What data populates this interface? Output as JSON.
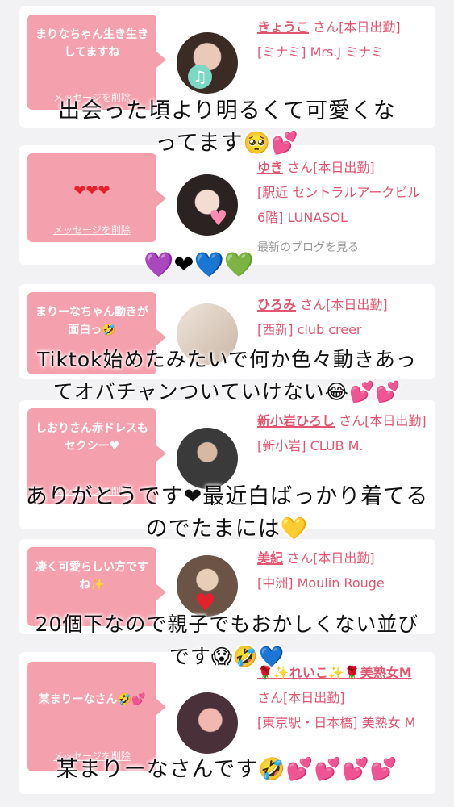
{
  "delete_label": "メッセージを削除",
  "blog_label": "最新のブログを見る",
  "cards": [
    {
      "message": "まりなちゃん生き生きしてますね",
      "name": "きょうこ",
      "san": "さん[本日出勤]",
      "shop": "[ミナミ] Mrs.J ミナミ"
    },
    {
      "message": "❤❤❤",
      "name": "ゆき",
      "san": "さん[本日出勤]",
      "shop": "[駅近 セントラルアークビル6階] LUNASOL"
    },
    {
      "message": "まりーなちゃん動きが面白っ🤣",
      "name": "ひろみ",
      "san": "さん[本日出勤]",
      "shop": "[西新] club creer"
    },
    {
      "message": "しおりさん赤ドレスもセクシー♥",
      "name": "新小岩ひろし",
      "san": "さん[本日出勤]",
      "shop": "[新小岩] CLUB M."
    },
    {
      "message": "凄く可愛らしい方ですね✨",
      "name": "美紀",
      "san": "さん[本日出勤]",
      "shop": "[中洲] Moulin Rouge"
    },
    {
      "message": "某まりーなさん🤣💕",
      "name": "🌹✨れいこ✨🌹美熟女M",
      "san": "さん[本日出勤]",
      "shop": "[東京駅・日本橋] 美熟女 M"
    }
  ],
  "captions": [
    {
      "line1": "出会った頃より明るくて可愛くな",
      "line2": "ってます🥺💕"
    },
    {
      "line1": "💜❤💙💚"
    },
    {
      "line1": "Tiktok始めたみたいで何か色々動きあっ",
      "line2": "てオバチャンついていけない😂💕💕"
    },
    {
      "line1": "ありがとうです❤最近白ばっかり着てる",
      "line2": "のでたまには💛"
    },
    {
      "line1": "20個下なので親子でもおかしくない並び",
      "line2": "です😱🤣💙"
    },
    {
      "line1": "某まりーなさんです🤣💕💕💕💕"
    }
  ],
  "colors": {
    "accent": "#e3566f",
    "bubble": "#f5a0ad",
    "background": "#f2f2f4"
  }
}
